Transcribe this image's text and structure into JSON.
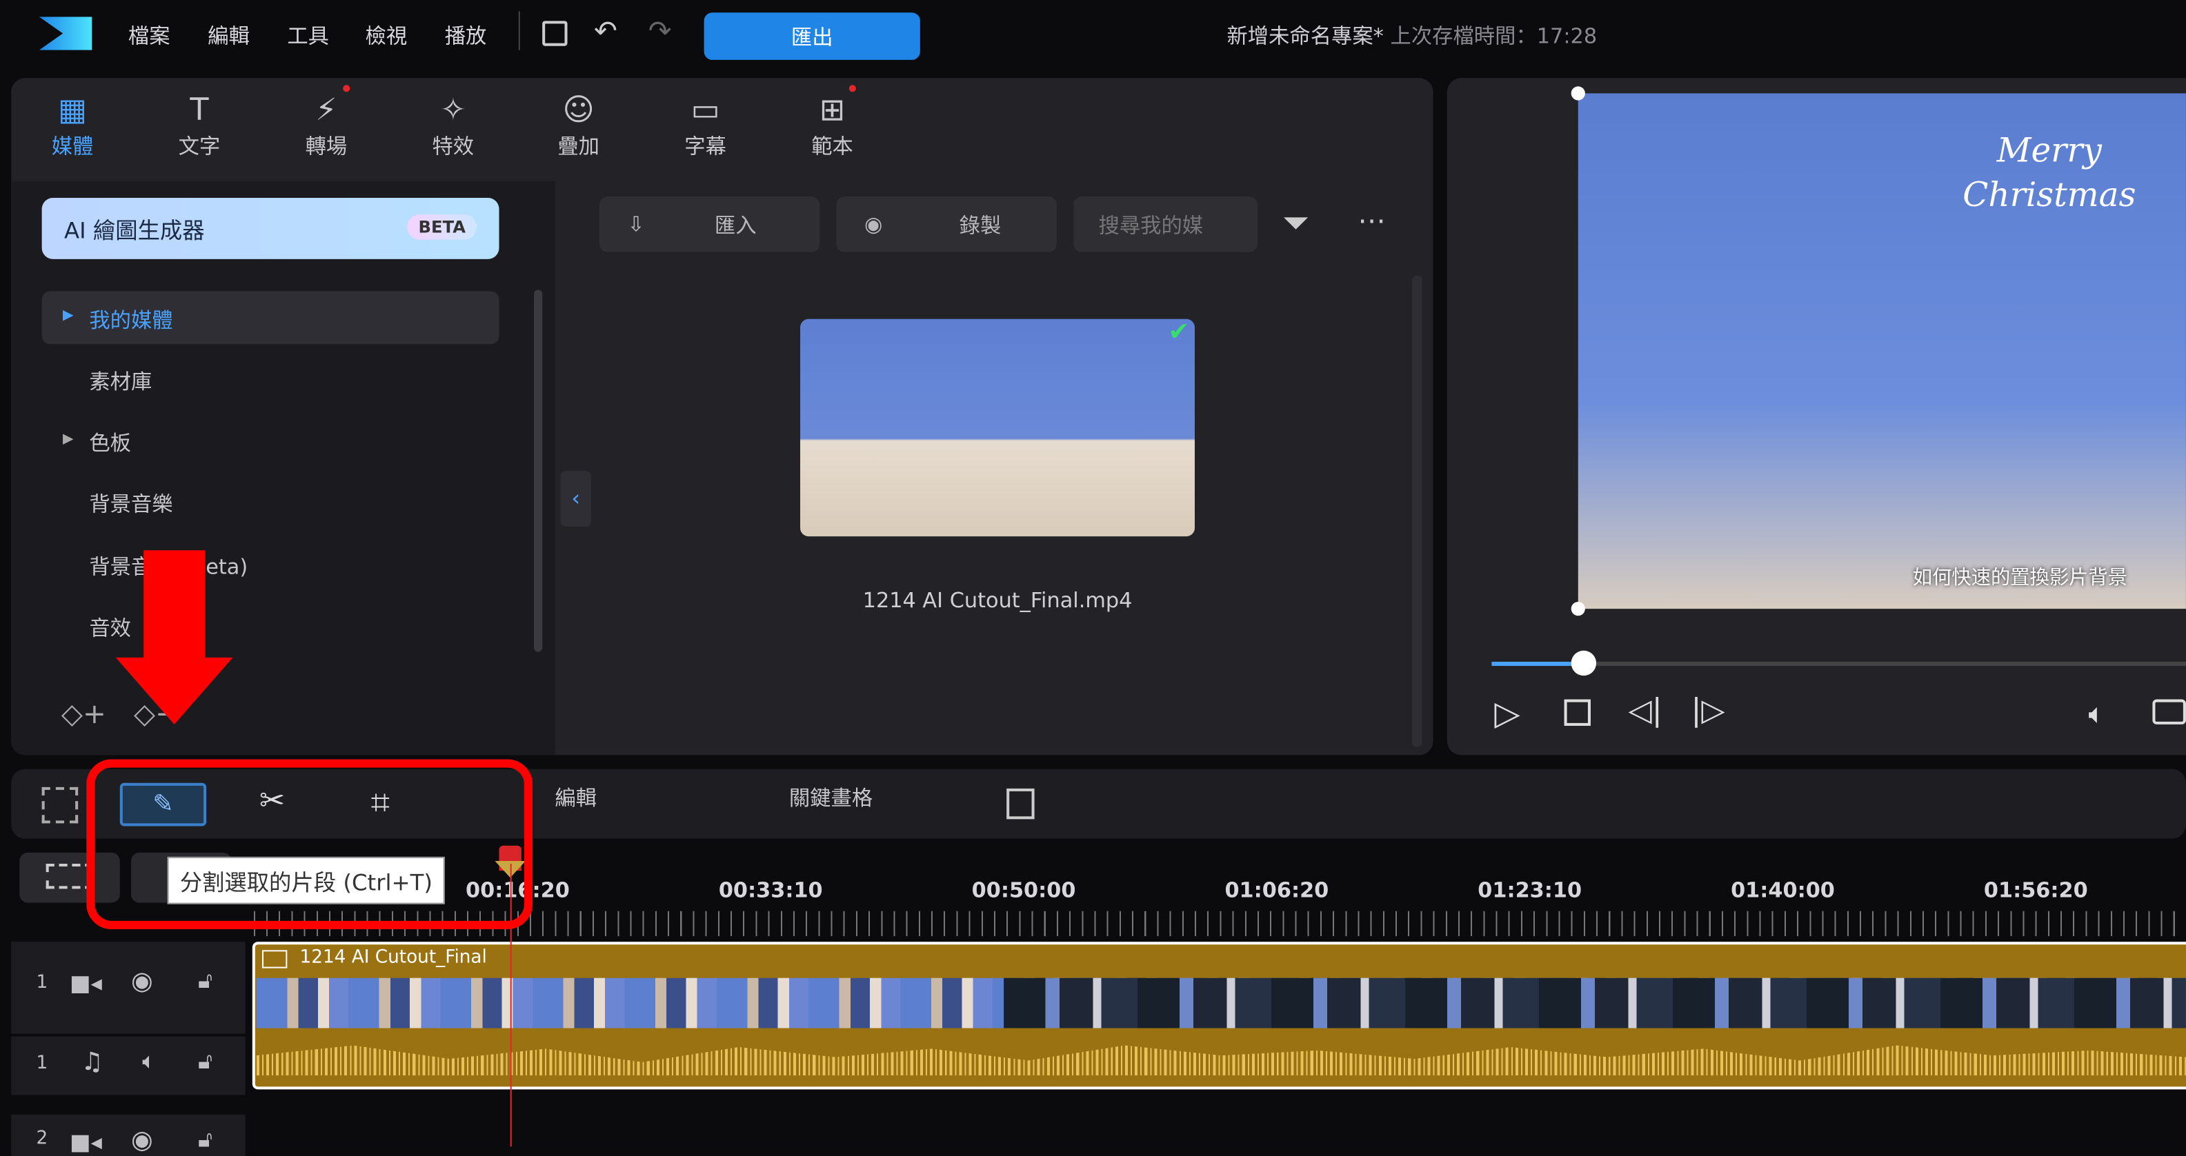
{
  "app": {
    "menu": [
      "檔案",
      "編輯",
      "工具",
      "檢視",
      "播放"
    ],
    "export_label": "匯出",
    "project_title": "新增未命名專案*",
    "last_saved": "上次存檔時間：17:28"
  },
  "room_tabs": [
    {
      "label": "媒體",
      "active": true
    },
    {
      "label": "文字"
    },
    {
      "label": "轉場",
      "badge": true
    },
    {
      "label": "特效"
    },
    {
      "label": "疊加"
    },
    {
      "label": "字幕"
    },
    {
      "label": "範本",
      "badge": true
    }
  ],
  "sidebar": {
    "ai_label": "AI 繪圖生成器",
    "beta": "BETA",
    "items": [
      "我的媒體",
      "素材庫",
      "色板",
      "背景音樂",
      "背景音樂 (Meta)",
      "音效"
    ]
  },
  "media": {
    "import_label": "匯入",
    "record_label": "錄製",
    "search_placeholder": "搜尋我的媒",
    "file_name": "1214 AI Cutout_Final.mp4"
  },
  "preview": {
    "caption_title": "Merry Christmas",
    "subtitle": "如何快速的置換影片背景",
    "progress": 0.04
  },
  "timeline": {
    "tools": {
      "edit": "編輯",
      "keyframe": "關鍵畫格"
    },
    "tooltip": "分割選取的片段 (Ctrl+T)",
    "ruler": [
      "00:16:20",
      "00:33:10",
      "00:50:00",
      "01:06:20",
      "01:23:10",
      "01:40:00",
      "01:56:20"
    ],
    "tracks": [
      {
        "num": "1",
        "type": "video"
      },
      {
        "num": "1",
        "type": "audio"
      },
      {
        "num": "2",
        "type": "video"
      }
    ],
    "clip_name": "1214 AI Cutout_Final"
  },
  "colors": {
    "accent": "#1f86e8",
    "clip": "#9a7212",
    "annotation": "#ff0000"
  }
}
